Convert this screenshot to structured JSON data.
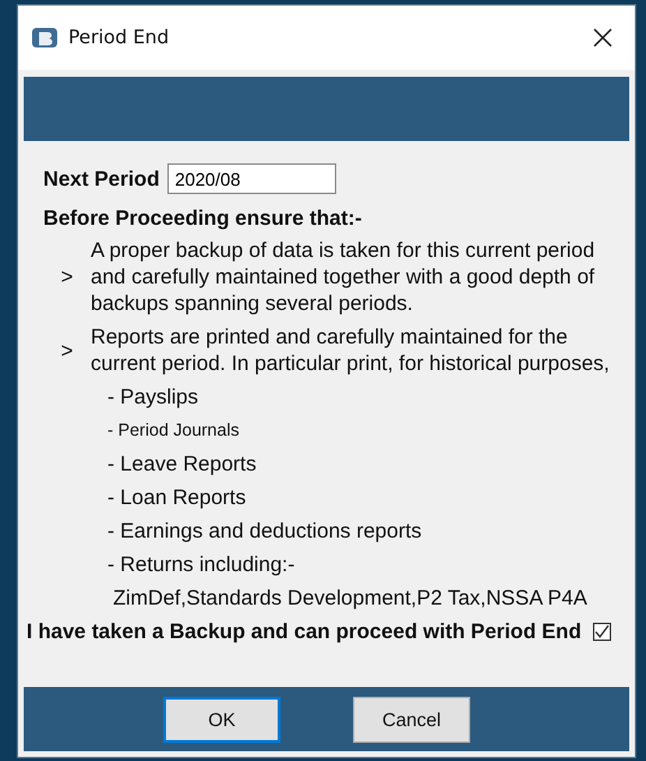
{
  "window": {
    "title": "Period End"
  },
  "next_period": {
    "label": "Next Period",
    "value": "2020/08"
  },
  "heading": "Before Proceeding ensure that:-",
  "points": [
    {
      "marker": ">",
      "text": "A proper backup of data is taken for this current period and carefully maintained together with a good depth of backups spanning several periods."
    },
    {
      "marker": ">",
      "text": "Reports are printed and carefully maintained for the current period. In particular print, for historical purposes,"
    }
  ],
  "report_items": [
    {
      "kind": "item",
      "text": "- Payslips"
    },
    {
      "kind": "small",
      "text": "- Period Journals"
    },
    {
      "kind": "item",
      "text": "- Leave Reports"
    },
    {
      "kind": "item",
      "text": "- Loan Reports"
    },
    {
      "kind": "item",
      "text": "- Earnings and deductions reports"
    },
    {
      "kind": "item",
      "text": "- Returns including:-"
    },
    {
      "kind": "continuation",
      "text": "ZimDef,Standards Development,P2 Tax,NSSA P4A"
    }
  ],
  "confirm": {
    "label": "I have taken a Backup and can proceed with Period End",
    "checked": true
  },
  "buttons": [
    {
      "label": "OK",
      "default": true
    },
    {
      "label": "Cancel",
      "default": false
    }
  ]
}
